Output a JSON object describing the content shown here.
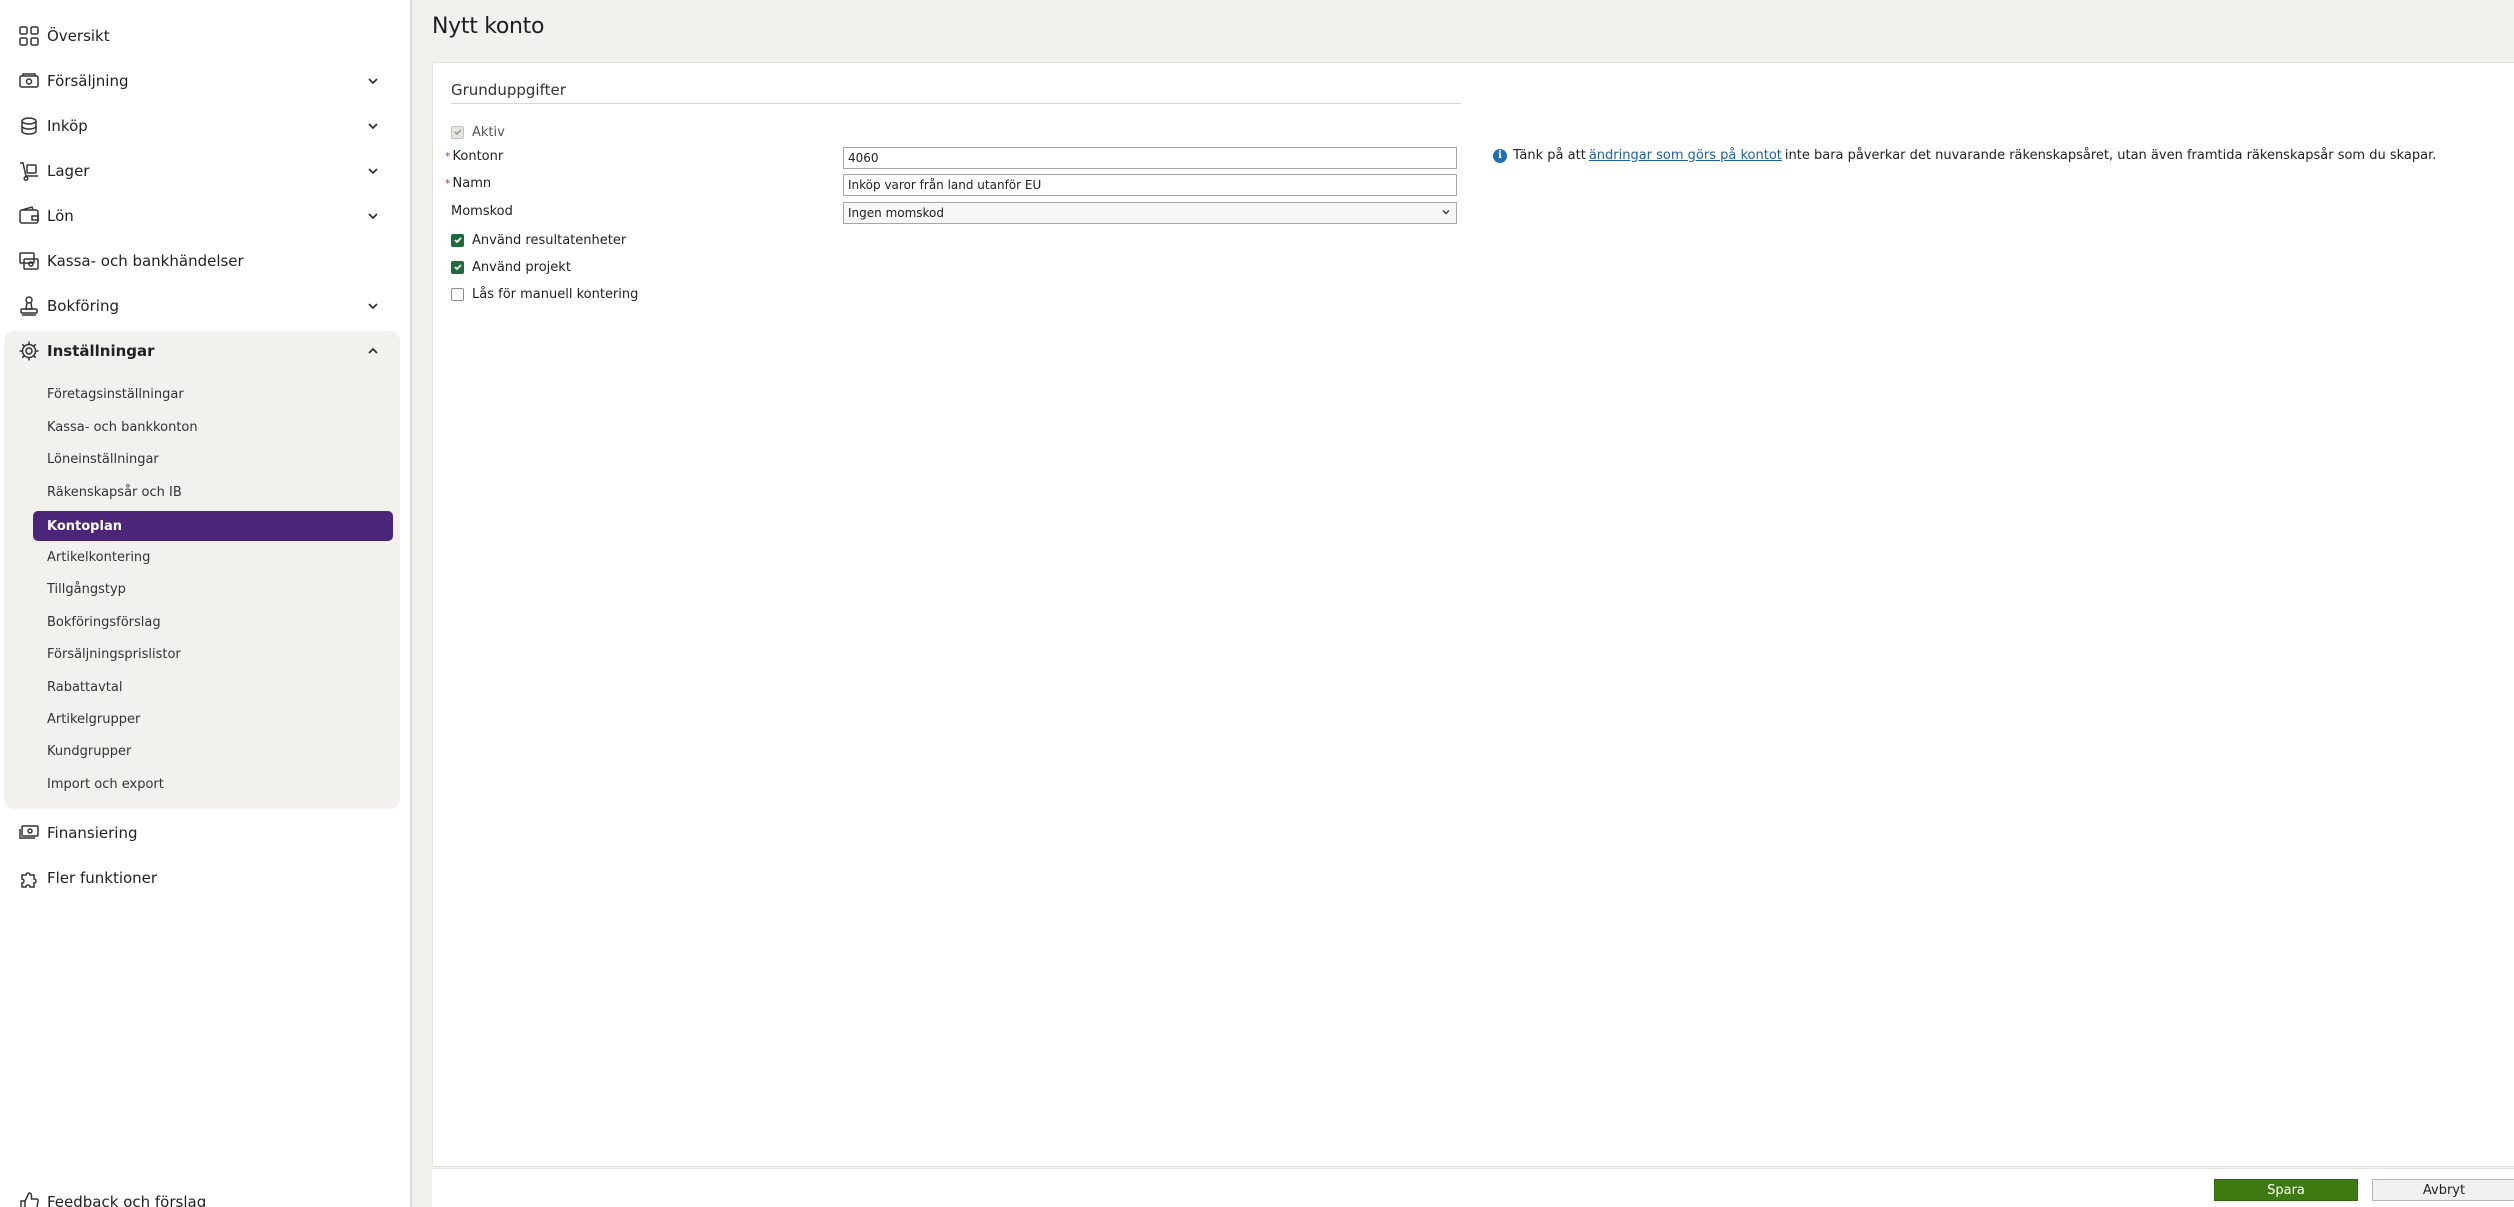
{
  "sidebar": {
    "items": [
      {
        "label": "Översikt",
        "icon": "grid-icon"
      },
      {
        "label": "Försäljning",
        "icon": "cash-register-icon"
      },
      {
        "label": "Inköp",
        "icon": "coins-icon"
      },
      {
        "label": "Lager",
        "icon": "dolly-icon"
      },
      {
        "label": "Lön",
        "icon": "wallet-icon"
      },
      {
        "label": "Kassa- och bankhändelser",
        "icon": "bank-money-icon"
      },
      {
        "label": "Bokföring",
        "icon": "stamp-icon"
      },
      {
        "label": "Inställningar",
        "icon": "gear-icon"
      },
      {
        "label": "Finansiering",
        "icon": "money-stack-icon"
      },
      {
        "label": "Fler funktioner",
        "icon": "puzzle-icon"
      },
      {
        "label": "Feedback och förslag",
        "icon": "thumbs-up-icon"
      }
    ],
    "settings_sub": [
      "Företagsinställningar",
      "Kassa- och bankkonton",
      "Löneinställningar",
      "Räkenskapsår och IB",
      "Kontoplan",
      "Artikelkontering",
      "Tillgångstyp",
      "Bokföringsförslag",
      "Försäljningsprislistor",
      "Rabattavtal",
      "Artikelgrupper",
      "Kundgrupper",
      "Import och export"
    ],
    "active_sub": "Kontoplan",
    "accent_color": "#4a2578"
  },
  "main": {
    "title": "Nytt konto",
    "section_title": "Grunduppgifter",
    "fields": {
      "aktiv_label": "Aktiv",
      "aktiv_checked": true,
      "kontonr_label": "Kontonr",
      "kontonr_value": "4060",
      "namn_label": "Namn",
      "namn_value": "Inköp varor från land utanför EU",
      "momskod_label": "Momskod",
      "momskod_value": "Ingen momskod",
      "resultatenheter_label": "Använd resultatenheter",
      "resultatenheter_checked": true,
      "projekt_label": "Använd projekt",
      "projekt_checked": true,
      "las_label": "Lås för manuell kontering",
      "las_checked": false,
      "required_marker": "*"
    },
    "info": {
      "prefix": "Tänk på att",
      "link": "ändringar som görs på kontot",
      "suffix": "inte bara påverkar det nuvarande räkenskapsåret, utan även framtida räkenskapsår som du skapar."
    },
    "footer": {
      "save_label": "Spara",
      "cancel_label": "Avbryt"
    }
  }
}
